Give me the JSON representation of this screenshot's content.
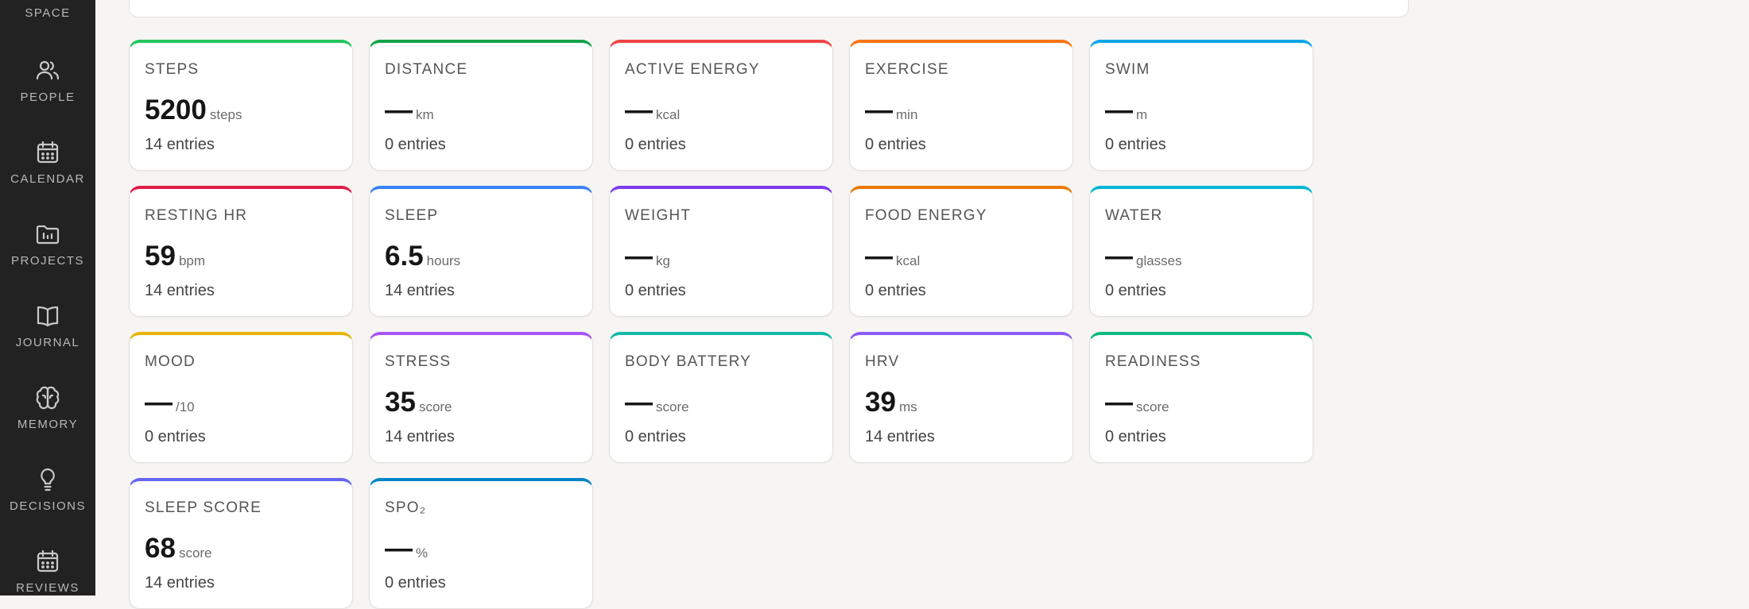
{
  "sidebar": {
    "items": [
      {
        "label": "Space",
        "icon": "space-icon"
      },
      {
        "label": "People",
        "icon": "people-icon"
      },
      {
        "label": "Calendar",
        "icon": "calendar-icon"
      },
      {
        "label": "Projects",
        "icon": "projects-folder-icon"
      },
      {
        "label": "Journal",
        "icon": "journal-book-icon"
      },
      {
        "label": "Memory",
        "icon": "memory-brain-icon"
      },
      {
        "label": "Decisions",
        "icon": "decisions-lightbulb-icon"
      },
      {
        "label": "Reviews",
        "icon": "reviews-calendar-icon"
      }
    ]
  },
  "metrics": [
    {
      "label": "STEPS",
      "value": "5200",
      "unit": "steps",
      "entries": "14 entries",
      "color": "#22c55e"
    },
    {
      "label": "DISTANCE",
      "value": "—",
      "unit": "km",
      "entries": "0 entries",
      "color": "#16a34a"
    },
    {
      "label": "ACTIVE ENERGY",
      "value": "—",
      "unit": "kcal",
      "entries": "0 entries",
      "color": "#ef4444"
    },
    {
      "label": "EXERCISE",
      "value": "—",
      "unit": "min",
      "entries": "0 entries",
      "color": "#f97316"
    },
    {
      "label": "SWIM",
      "value": "—",
      "unit": "m",
      "entries": "0 entries",
      "color": "#0ea5e9"
    },
    {
      "label": "RESTING HR",
      "value": "59",
      "unit": "bpm",
      "entries": "14 entries",
      "color": "#e11d48"
    },
    {
      "label": "SLEEP",
      "value": "6.5",
      "unit": "hours",
      "entries": "14 entries",
      "color": "#3b82f6"
    },
    {
      "label": "WEIGHT",
      "value": "—",
      "unit": "kg",
      "entries": "0 entries",
      "color": "#7c3aed"
    },
    {
      "label": "FOOD ENERGY",
      "value": "—",
      "unit": "kcal",
      "entries": "0 entries",
      "color": "#ea7a08"
    },
    {
      "label": "WATER",
      "value": "—",
      "unit": "glasses",
      "entries": "0 entries",
      "color": "#06b6d4"
    },
    {
      "label": "MOOD",
      "value": "—",
      "unit": "/10",
      "entries": "0 entries",
      "color": "#eab308"
    },
    {
      "label": "STRESS",
      "value": "35",
      "unit": "score",
      "entries": "14 entries",
      "color": "#a855f7"
    },
    {
      "label": "BODY BATTERY",
      "value": "—",
      "unit": "score",
      "entries": "0 entries",
      "color": "#14b8a6"
    },
    {
      "label": "HRV",
      "value": "39",
      "unit": "ms",
      "entries": "14 entries",
      "color": "#8b5cf6"
    },
    {
      "label": "READINESS",
      "value": "—",
      "unit": "score",
      "entries": "0 entries",
      "color": "#10b981"
    },
    {
      "label": "SLEEP SCORE",
      "value": "68",
      "unit": "score",
      "entries": "14 entries",
      "color": "#6366f1"
    },
    {
      "label": "SPO₂",
      "value": "—",
      "unit": "%",
      "entries": "0 entries",
      "color": "#0284c7"
    }
  ]
}
